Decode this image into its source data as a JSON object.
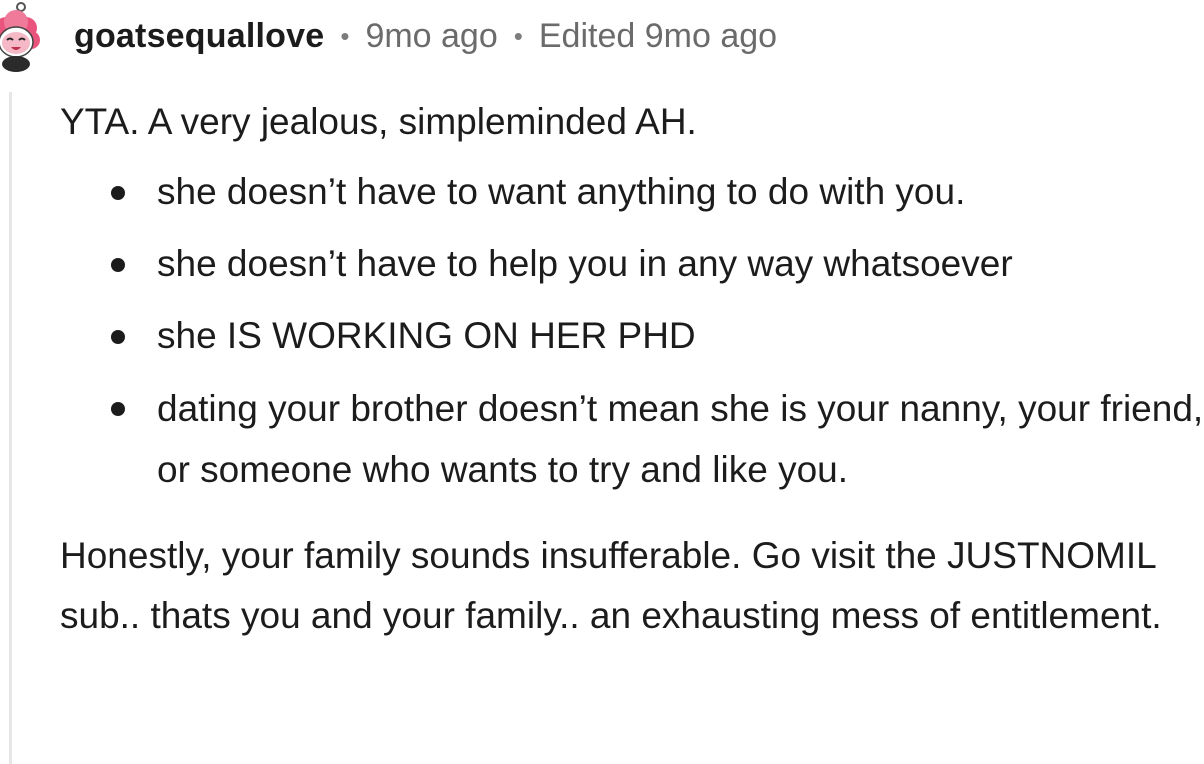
{
  "comment": {
    "username": "goatsequallove",
    "separator": "•",
    "time_ago": "9mo ago",
    "edited": "Edited 9mo ago",
    "body": {
      "intro": "YTA. A very jealous, simpleminded AH.",
      "bullets": [
        "she doesn’t have to want anything to do with you.",
        "she doesn’t have to help you in any way whatsoever",
        "she IS WORKING ON HER PHD",
        "dating your brother doesn’t mean she is your nanny, your friend, or someone who wants to try and like you."
      ],
      "closing": "Honestly, your family sounds insufferable. Go visit the JUSTNOMIL sub.. thats you and your family.. an exhausting mess of entitlement."
    }
  },
  "colors": {
    "text": "#1c1c1c",
    "meta": "#6b6b6b",
    "thread_line": "#e4e6e8",
    "avatar_pink": "#f07a9a"
  },
  "icons": {
    "avatar": "avatar-snoo-pink-hair"
  }
}
